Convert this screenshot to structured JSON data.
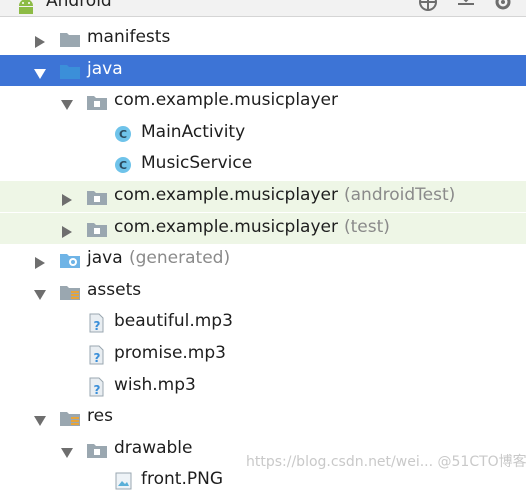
{
  "header": {
    "title": "Android",
    "icons": [
      "android-logo-icon",
      "target-icon",
      "collapse-all-icon",
      "gear-icon"
    ]
  },
  "tree": [
    {
      "id": "manifests",
      "label": "manifests",
      "indent": 0,
      "expanded": false,
      "icon": "folder-icon"
    },
    {
      "id": "java",
      "label": "java",
      "indent": 0,
      "expanded": true,
      "selected": true,
      "icon": "source-folder-icon"
    },
    {
      "id": "pkg-main",
      "label": "com.example.musicplayer",
      "indent": 1,
      "expanded": true,
      "icon": "package-icon"
    },
    {
      "id": "mainactivity",
      "label": "MainActivity",
      "indent": 2,
      "icon": "class-icon",
      "class_letter": "C"
    },
    {
      "id": "musicservice",
      "label": "MusicService",
      "indent": 2,
      "icon": "class-icon",
      "class_letter": "C"
    },
    {
      "id": "pkg-androidtest",
      "label": "com.example.musicplayer",
      "suffix": "(androidTest)",
      "indent": 1,
      "expanded": false,
      "icon": "package-icon",
      "highlight": "test"
    },
    {
      "id": "pkg-test",
      "label": "com.example.musicplayer",
      "suffix": "(test)",
      "indent": 1,
      "expanded": false,
      "icon": "package-icon",
      "highlight": "test"
    },
    {
      "id": "java-generated",
      "label": "java",
      "suffix": "(generated)",
      "indent": 0,
      "expanded": false,
      "icon": "generated-folder-icon"
    },
    {
      "id": "assets",
      "label": "assets",
      "indent": 0,
      "expanded": true,
      "icon": "resource-folder-icon"
    },
    {
      "id": "beautiful",
      "label": "beautiful.mp3",
      "indent": 1,
      "icon": "unknown-file-icon"
    },
    {
      "id": "promise",
      "label": "promise.mp3",
      "indent": 1,
      "icon": "unknown-file-icon"
    },
    {
      "id": "wish",
      "label": "wish.mp3",
      "indent": 1,
      "icon": "unknown-file-icon"
    },
    {
      "id": "res",
      "label": "res",
      "indent": 0,
      "expanded": true,
      "icon": "resource-folder-icon"
    },
    {
      "id": "drawable",
      "label": "drawable",
      "indent": 1,
      "expanded": true,
      "icon": "package-icon"
    },
    {
      "id": "front-png",
      "label": "front.PNG",
      "indent": 2,
      "icon": "image-file-icon"
    }
  ],
  "watermark": "https://blog.csdn.net/wei... @51CTO博客",
  "colors": {
    "selection": "#3d74d6",
    "test_highlight": "#eef6e6",
    "class_icon": "#6fc3ea",
    "folder_blue": "#3b8fd9",
    "package_gray": "#9aa7b0"
  }
}
